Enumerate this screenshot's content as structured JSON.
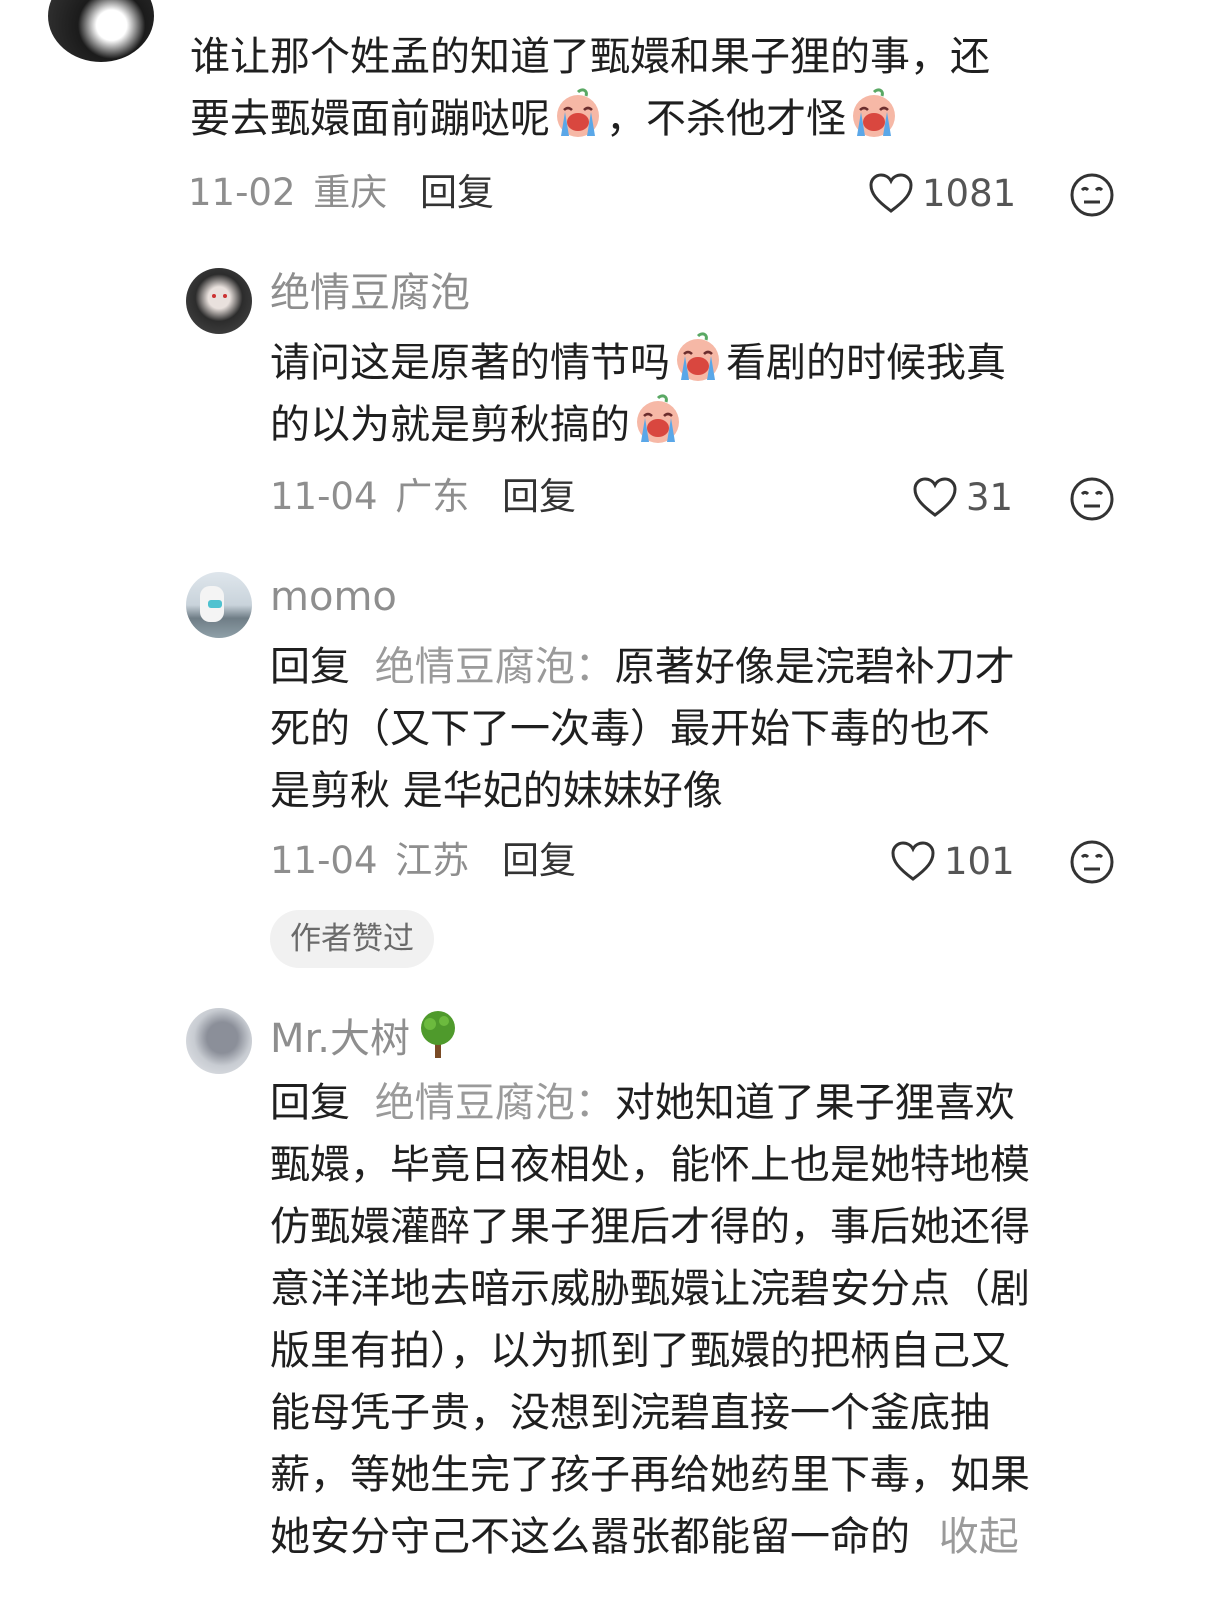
{
  "comments": [
    {
      "lines": [
        "谁让那个姓孟的知道了甄嬛和果子狸的事，还",
        "要去甄嬛面前蹦哒呢",
        "，不杀他才怪"
      ],
      "date": "11-02",
      "location": "重庆",
      "reply_label": "回复",
      "likes": "1081"
    },
    {
      "username": "绝情豆腐泡",
      "lines": [
        "请问这是原著的情节吗",
        "看剧的时候我真",
        "的以为就是剪秋搞的"
      ],
      "date": "11-04",
      "location": "广东",
      "reply_label": "回复",
      "likes": "31"
    },
    {
      "username": "momo",
      "reply_prefix": "回复",
      "reply_target": "绝情豆腐泡：",
      "lines": [
        "原著好像是浣碧补刀才",
        "死的（又下了一次毒）最开始下毒的也不",
        "是剪秋 是华妃的妹妹好像"
      ],
      "date": "11-04",
      "location": "江苏",
      "reply_label": "回复",
      "likes": "101",
      "badge": "作者赞过"
    },
    {
      "username": "Mr.大树",
      "reply_prefix": "回复",
      "reply_target": "绝情豆腐泡：",
      "lines": [
        "对她知道了果子狸喜欢",
        "甄嬛，毕竟日夜相处，能怀上也是她特地模",
        "仿甄嬛灌醉了果子狸后才得的，事后她还得",
        "意洋洋地去暗示威胁甄嬛让浣碧安分点（剧",
        "版里有拍），以为抓到了甄嬛的把柄自己又",
        "能母凭子贵，没想到浣碧直接一个釜底抽",
        "薪，等她生完了孩子再给她药里下毒，如果",
        "她安分守己不这么嚣张都能留一命的"
      ],
      "collapse_label": "收起"
    }
  ],
  "icons": {
    "emoji": "crying-face-emoji",
    "tree": "tree-emoji",
    "like": "heart-outline-icon",
    "more": "neutral-face-icon"
  }
}
